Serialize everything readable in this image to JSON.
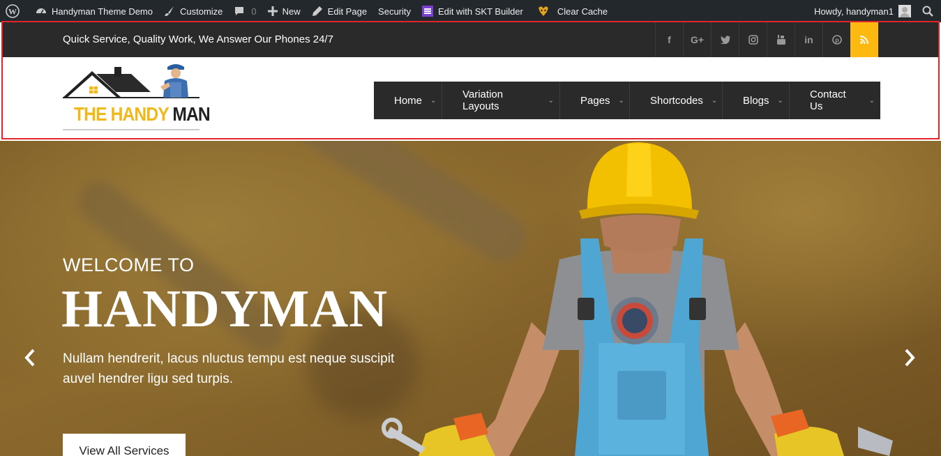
{
  "adminbar": {
    "site_name": "Handyman Theme Demo",
    "customize": "Customize",
    "comments_count": "0",
    "new": "New",
    "edit_page": "Edit Page",
    "security": "Security",
    "skt_builder": "Edit with SKT Builder",
    "clear_cache": "Clear Cache",
    "howdy": "Howdy, handyman1"
  },
  "topbar": {
    "tagline": "Quick Service, Quality Work, We Answer Our Phones 24/7",
    "social": [
      {
        "icon": "facebook-icon",
        "glyph": "f"
      },
      {
        "icon": "google-plus-icon",
        "glyph": "G+"
      },
      {
        "icon": "twitter-icon",
        "glyph": "🐦"
      },
      {
        "icon": "instagram-icon",
        "glyph": "◎"
      },
      {
        "icon": "youtube-icon",
        "glyph": "▶"
      },
      {
        "icon": "linkedin-icon",
        "glyph": "in"
      },
      {
        "icon": "pinterest-icon",
        "glyph": "P"
      },
      {
        "icon": "rss-icon",
        "glyph": "☰"
      }
    ],
    "accent_color": "#fdb90f"
  },
  "logo": {
    "word1": "THE HANDY",
    "word2": "MAN"
  },
  "nav": {
    "items": [
      "Home",
      "Variation Layouts",
      "Pages",
      "Shortcodes",
      "Blogs",
      "Contact Us"
    ]
  },
  "hero": {
    "welcome": "WELCOME TO",
    "title": "HANDYMAN",
    "description": "Nullam hendrerit, lacus nluctus tempu est neque suscipit auvel hendrer ligu sed turpis.",
    "button": "View All Services"
  }
}
